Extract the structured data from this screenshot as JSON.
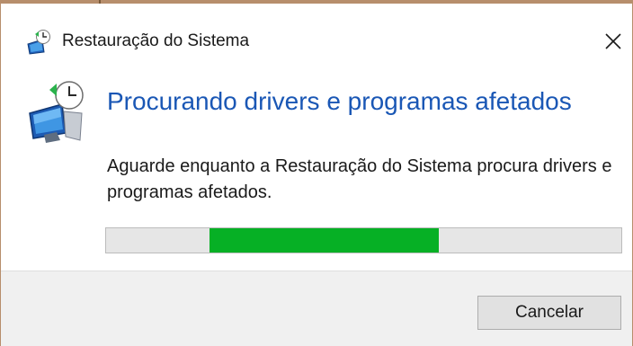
{
  "window": {
    "title": "Restauração do Sistema",
    "title_icon": "system-restore-icon",
    "close_icon": "close-icon",
    "frame_color": "#b78e6c"
  },
  "main": {
    "icon": "system-restore-computer-icon",
    "heading": "Procurando drivers e programas afetados",
    "heading_color": "#1a57b5",
    "message": "Aguarde enquanto a Restauração do Sistema procura drivers e programas afetados.",
    "progress": {
      "style": "marquee",
      "segment_start": 0.2,
      "segment_end": 0.645,
      "fill_color": "#06b025",
      "track_color": "#e6e6e6"
    }
  },
  "footer": {
    "cancel_label": "Cancelar"
  }
}
